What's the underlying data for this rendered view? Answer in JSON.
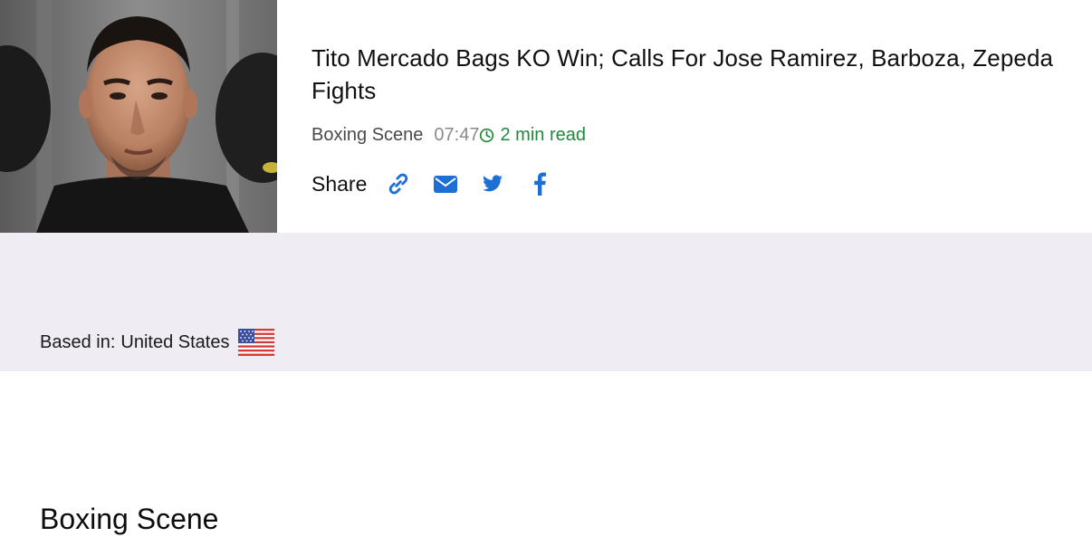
{
  "article": {
    "headline": "Tito Mercado Bags KO Win; Calls For Jose Ramirez, Barboza, Zepeda Fights",
    "source": "Boxing Scene",
    "time": "07:47",
    "read_time": "2 min read",
    "read_icon": "clock-icon",
    "thumbnail_alt": "boxer-portrait"
  },
  "share": {
    "label": "Share",
    "buttons": [
      {
        "name": "copy-link",
        "icon": "link-icon"
      },
      {
        "name": "email",
        "icon": "envelope-icon"
      },
      {
        "name": "twitter",
        "icon": "twitter-icon"
      },
      {
        "name": "facebook",
        "icon": "facebook-icon"
      }
    ]
  },
  "publisher": {
    "name": "Boxing Scene",
    "based_label": "Based in:",
    "country": "United States",
    "flag_icon": "us-flag-icon"
  },
  "colors": {
    "accent_blue": "#1d6fd6",
    "read_green": "#1e8a3a",
    "panel_bg": "#efedf3"
  }
}
